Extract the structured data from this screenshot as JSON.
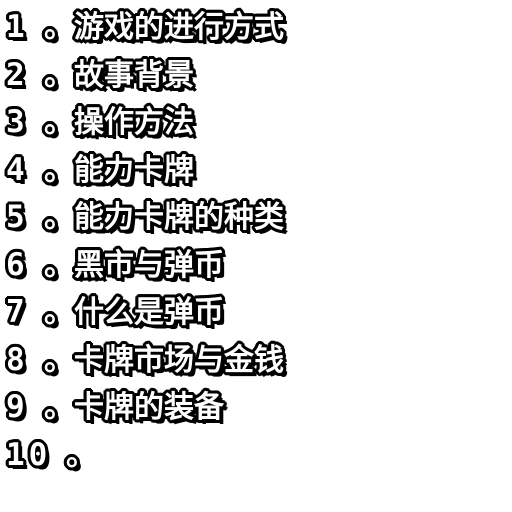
{
  "menu": {
    "separator": "。",
    "items": [
      {
        "number": "1",
        "label": "游戏的进行方式"
      },
      {
        "number": "2",
        "label": "故事背景"
      },
      {
        "number": "3",
        "label": "操作方法"
      },
      {
        "number": "4",
        "label": "能力卡牌"
      },
      {
        "number": "5",
        "label": "能力卡牌的种类"
      },
      {
        "number": "6",
        "label": "黑市与弹币"
      },
      {
        "number": "7",
        "label": "什么是弹币"
      },
      {
        "number": "8",
        "label": "卡牌市场与金钱"
      },
      {
        "number": "9",
        "label": "卡牌的装备"
      },
      {
        "number": "10",
        "label": ""
      }
    ]
  }
}
